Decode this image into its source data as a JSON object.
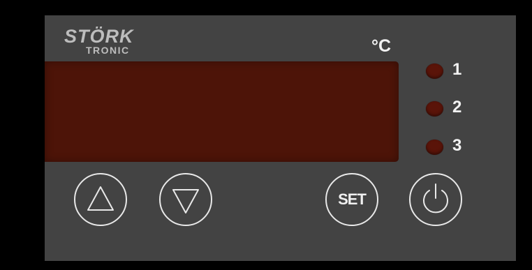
{
  "brand": {
    "name": "STÖRK",
    "subname": "TRONIC"
  },
  "display": {
    "unit": "°C",
    "value": ""
  },
  "indicators": [
    {
      "label": "1",
      "state": "off",
      "color": "#5a1409"
    },
    {
      "label": "2",
      "state": "off",
      "color": "#5a1409"
    },
    {
      "label": "3",
      "state": "off",
      "color": "#5a1409"
    }
  ],
  "buttons": {
    "up": {
      "icon": "triangle-up-icon"
    },
    "down": {
      "icon": "triangle-down-icon"
    },
    "set": {
      "label": "SET"
    },
    "power": {
      "icon": "power-icon"
    }
  },
  "colors": {
    "panel": "#434343",
    "display": "#4d1408",
    "led_off": "#5a1409",
    "text": "#f2f2f2"
  }
}
